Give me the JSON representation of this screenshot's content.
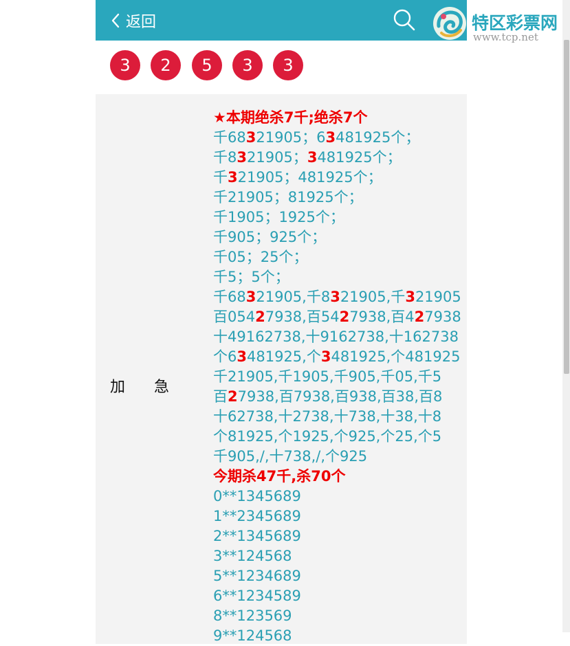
{
  "header": {
    "back_label": "返回"
  },
  "watermark": {
    "title": "特区彩票网",
    "url": "www.tcp.net"
  },
  "balls": [
    "3",
    "2",
    "5",
    "3",
    "3"
  ],
  "side_label": [
    "加",
    "急"
  ],
  "lines": [
    {
      "hl": true,
      "parts": [
        {
          "t": "★本期绝杀7千"
        },
        {
          "t": ";"
        },
        {
          "t": "绝杀7个"
        }
      ]
    },
    {
      "hl": false,
      "parts": [
        {
          "t": "千68"
        },
        {
          "t": "3",
          "r": true
        },
        {
          "t": "21905；6"
        },
        {
          "t": "3",
          "r": true
        },
        {
          "t": "481925个；"
        }
      ]
    },
    {
      "hl": false,
      "parts": [
        {
          "t": "千8"
        },
        {
          "t": "3",
          "r": true
        },
        {
          "t": "21905；"
        },
        {
          "t": "3",
          "r": true
        },
        {
          "t": "481925个；"
        }
      ]
    },
    {
      "hl": false,
      "parts": [
        {
          "t": "千"
        },
        {
          "t": "3",
          "r": true
        },
        {
          "t": "21905；481925个；"
        }
      ]
    },
    {
      "hl": false,
      "parts": [
        {
          "t": "千21905；81925个；"
        }
      ]
    },
    {
      "hl": false,
      "parts": [
        {
          "t": "千1905；1925个；"
        }
      ]
    },
    {
      "hl": false,
      "parts": [
        {
          "t": "千905；925个；"
        }
      ]
    },
    {
      "hl": false,
      "parts": [
        {
          "t": "千05；25个；"
        }
      ]
    },
    {
      "hl": false,
      "parts": [
        {
          "t": "千5；5个；"
        }
      ]
    },
    {
      "hl": false,
      "parts": [
        {
          "t": "千68"
        },
        {
          "t": "3",
          "r": true
        },
        {
          "t": "21905,千8"
        },
        {
          "t": "3",
          "r": true
        },
        {
          "t": "21905,千"
        },
        {
          "t": "3",
          "r": true
        },
        {
          "t": "21905"
        }
      ]
    },
    {
      "hl": false,
      "parts": [
        {
          "t": "百054"
        },
        {
          "t": "2",
          "r": true
        },
        {
          "t": "7938,百54"
        },
        {
          "t": "2",
          "r": true
        },
        {
          "t": "7938,百4"
        },
        {
          "t": "2",
          "r": true
        },
        {
          "t": "7938"
        }
      ]
    },
    {
      "hl": false,
      "parts": [
        {
          "t": "十49162738,十9162738,十162738"
        }
      ]
    },
    {
      "hl": false,
      "parts": [
        {
          "t": "个6"
        },
        {
          "t": "3",
          "r": true
        },
        {
          "t": "481925,个"
        },
        {
          "t": "3",
          "r": true
        },
        {
          "t": "481925,个481925"
        }
      ]
    },
    {
      "hl": false,
      "parts": [
        {
          "t": "千21905,千1905,千905,千05,千5"
        }
      ]
    },
    {
      "hl": false,
      "parts": [
        {
          "t": "百"
        },
        {
          "t": "2",
          "r": true
        },
        {
          "t": "7938,百7938,百938,百38,百8"
        }
      ]
    },
    {
      "hl": false,
      "parts": [
        {
          "t": "十62738,十2738,十738,十38,十8"
        }
      ]
    },
    {
      "hl": false,
      "parts": [
        {
          "t": "个81925,个1925,个925,个25,个5"
        }
      ]
    },
    {
      "hl": false,
      "parts": [
        {
          "t": "千905,/,十738,/,个925"
        }
      ]
    },
    {
      "hl": true,
      "parts": [
        {
          "t": "今期杀47千"
        },
        {
          "t": ","
        },
        {
          "t": "杀70个"
        }
      ]
    },
    {
      "hl": false,
      "parts": [
        {
          "t": "0**1345689"
        }
      ]
    },
    {
      "hl": false,
      "parts": [
        {
          "t": "1**2345689"
        }
      ]
    },
    {
      "hl": false,
      "parts": [
        {
          "t": "2**1345689"
        }
      ]
    },
    {
      "hl": false,
      "parts": [
        {
          "t": "3**124568"
        }
      ]
    },
    {
      "hl": false,
      "parts": [
        {
          "t": "5**1234689"
        }
      ]
    },
    {
      "hl": false,
      "parts": [
        {
          "t": "6**1234589"
        }
      ]
    },
    {
      "hl": false,
      "parts": [
        {
          "t": "8**123569"
        }
      ]
    },
    {
      "hl": false,
      "parts": [
        {
          "t": "9**124568"
        }
      ]
    }
  ],
  "colors": {
    "header_bg": "#2aa7bd",
    "ball_bg": "#dc1c3a",
    "text": "#2a9fb3",
    "highlight": "#ee0000",
    "content_bg": "#f3f3f3"
  },
  "icons": {
    "back": "chevron-left-icon",
    "search": "search-icon"
  }
}
